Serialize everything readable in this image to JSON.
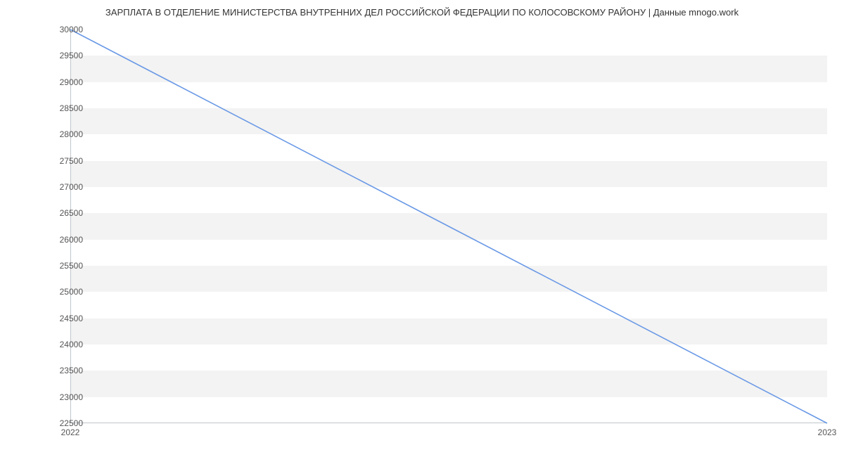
{
  "chart_data": {
    "type": "line",
    "title": "ЗАРПЛАТА В ОТДЕЛЕНИЕ МИНИСТЕРСТВА ВНУТРЕННИХ ДЕЛ РОССИЙСКОЙ ФЕДЕРАЦИИ ПО КОЛОСОВСКОМУ РАЙОНУ | Данные mnogo.work",
    "x": [
      "2022",
      "2023"
    ],
    "series": [
      {
        "name": "Зарплата",
        "values": [
          30000,
          22500
        ],
        "color": "#6a99e6"
      }
    ],
    "xlabel": "",
    "ylabel": "",
    "ylim": [
      22500,
      30000
    ],
    "y_ticks": [
      22500,
      23000,
      23500,
      24000,
      24500,
      25000,
      25500,
      26000,
      26500,
      27000,
      27500,
      28000,
      28500,
      29000,
      29500,
      30000
    ],
    "x_ticks": [
      "2022",
      "2023"
    ],
    "grid": true
  }
}
